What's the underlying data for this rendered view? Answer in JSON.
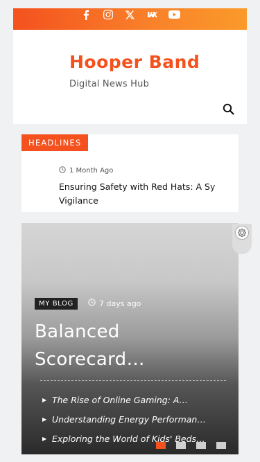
{
  "social": {
    "icons": [
      "facebook-icon",
      "instagram-icon",
      "x-icon",
      "vk-icon",
      "youtube-icon"
    ]
  },
  "header": {
    "brand": "Hooper Band",
    "tagline": "Digital News Hub"
  },
  "headlines": {
    "badge": "HEADLINES",
    "meta": "1 Month Ago",
    "title_line1": "Ensuring Safety with Red Hats: A Sy",
    "title_line2": "Vigilance"
  },
  "hero": {
    "category": "MY BLOG",
    "meta": "7 days ago",
    "title_line1": "Balanced",
    "title_line2": "Scorecard…",
    "list": [
      "The Rise of Online Gaming: A…",
      "Understanding Energy Performan…",
      "Exploring the World of Kids' Beds…"
    ],
    "slide_count": 4,
    "active_slide": 1
  },
  "colors": {
    "accent": "#f4511e",
    "topbar_end": "#fb9a2a"
  }
}
